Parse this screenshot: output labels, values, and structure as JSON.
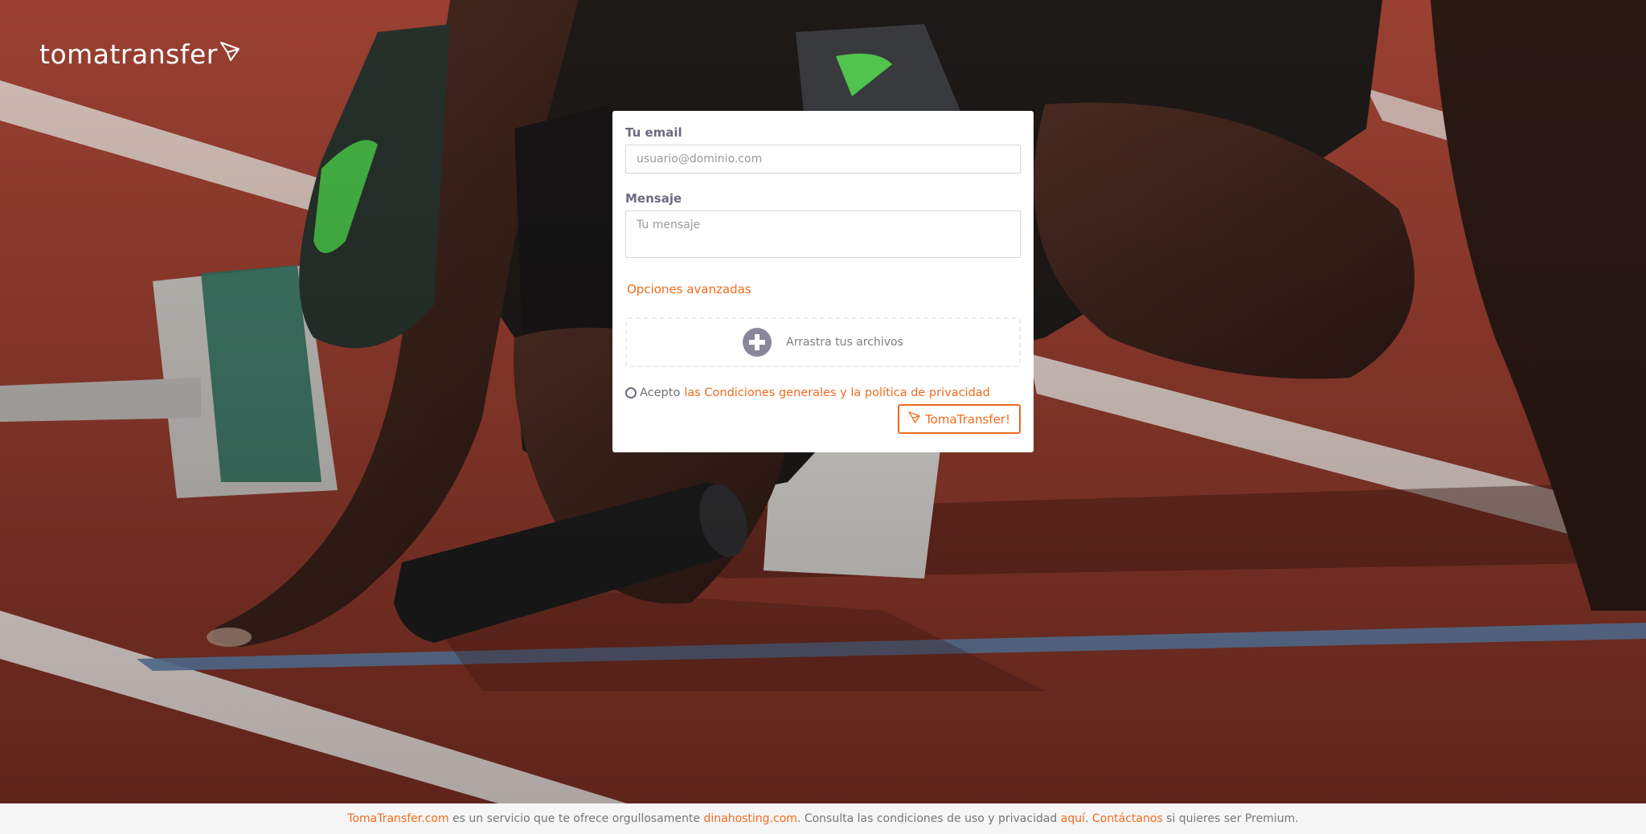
{
  "brand": {
    "logo_text": "tomatransfer",
    "logo_icon": "paper-plane-icon"
  },
  "form": {
    "email_label": "Tu email",
    "email_placeholder": "usuario@dominio.com",
    "message_label": "Mensaje",
    "message_placeholder": "Tu mensaje",
    "advanced_options": "Opciones avanzadas",
    "dropzone_text": "Arrastra tus archivos",
    "dropzone_icon": "plus-circle-icon",
    "terms_prefix": "Acepto",
    "terms_link": "las Condiciones generales y la política de privacidad",
    "submit_label": "TomaTransfer!",
    "submit_icon": "paper-plane-icon"
  },
  "footer": {
    "site_link": "TomaTransfer.com",
    "text_1": " es un servicio que te ofrece orgullosamente ",
    "host_link": "dinahosting.com",
    "text_2": ". Consulta las condiciones de uso y privacidad ",
    "here_link": "aquí",
    "text_3": ". ",
    "contact_link": "Contáctanos",
    "text_4": " si quieres ser Premium."
  },
  "colors": {
    "accent": "#f06b1f",
    "label": "#6c6a80",
    "track": "#8e3a2c",
    "footer_bg": "#f6f6f6"
  }
}
